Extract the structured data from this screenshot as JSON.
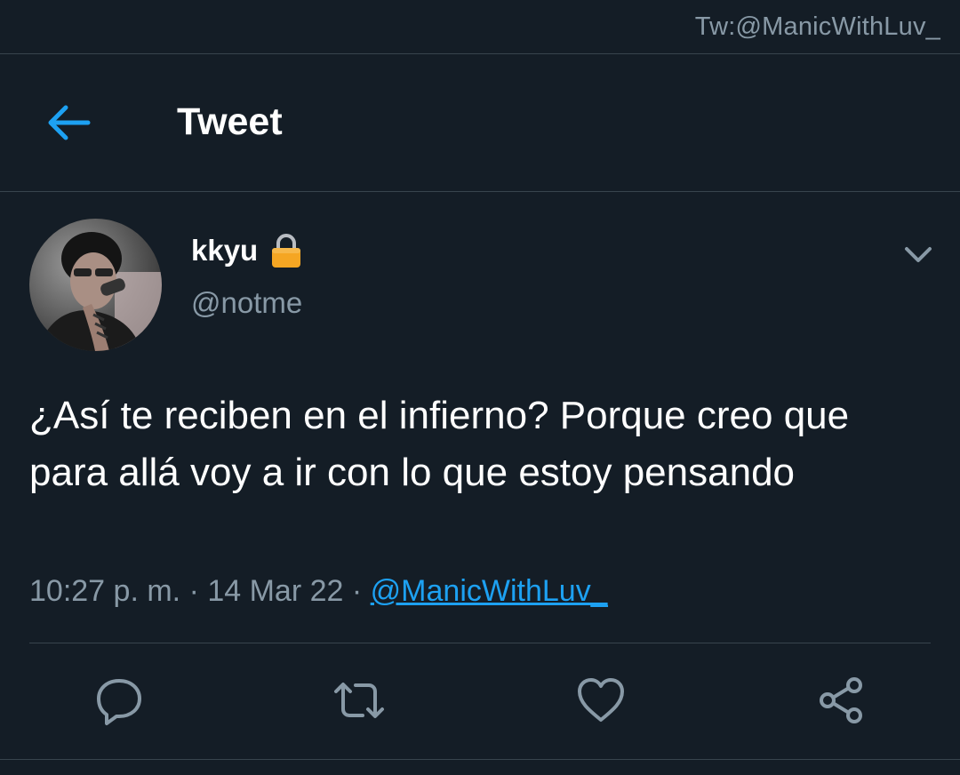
{
  "watermark": "Tw:@ManicWithLuv_",
  "header": {
    "title": "Tweet"
  },
  "tweet": {
    "author": {
      "display_name": "kkyu",
      "handle": "@notme"
    },
    "text": "¿Así te reciben en el infierno? Porque creo que para allá voy a ir con lo que estoy pensando",
    "time": "10:27 p. m.",
    "separator": "·",
    "date": "14 Mar 22",
    "via": "@ManicWithLuv_"
  },
  "colors": {
    "background": "#141d26",
    "accent": "#1da1f2",
    "secondary_text": "#8899a6",
    "divider": "#38444d",
    "lock": "#f5a623"
  },
  "icons": {
    "back": "arrow-left-icon",
    "lock": "lock-icon",
    "caret": "chevron-down-icon",
    "reply": "reply-icon",
    "retweet": "retweet-icon",
    "like": "heart-icon",
    "share": "share-icon"
  }
}
